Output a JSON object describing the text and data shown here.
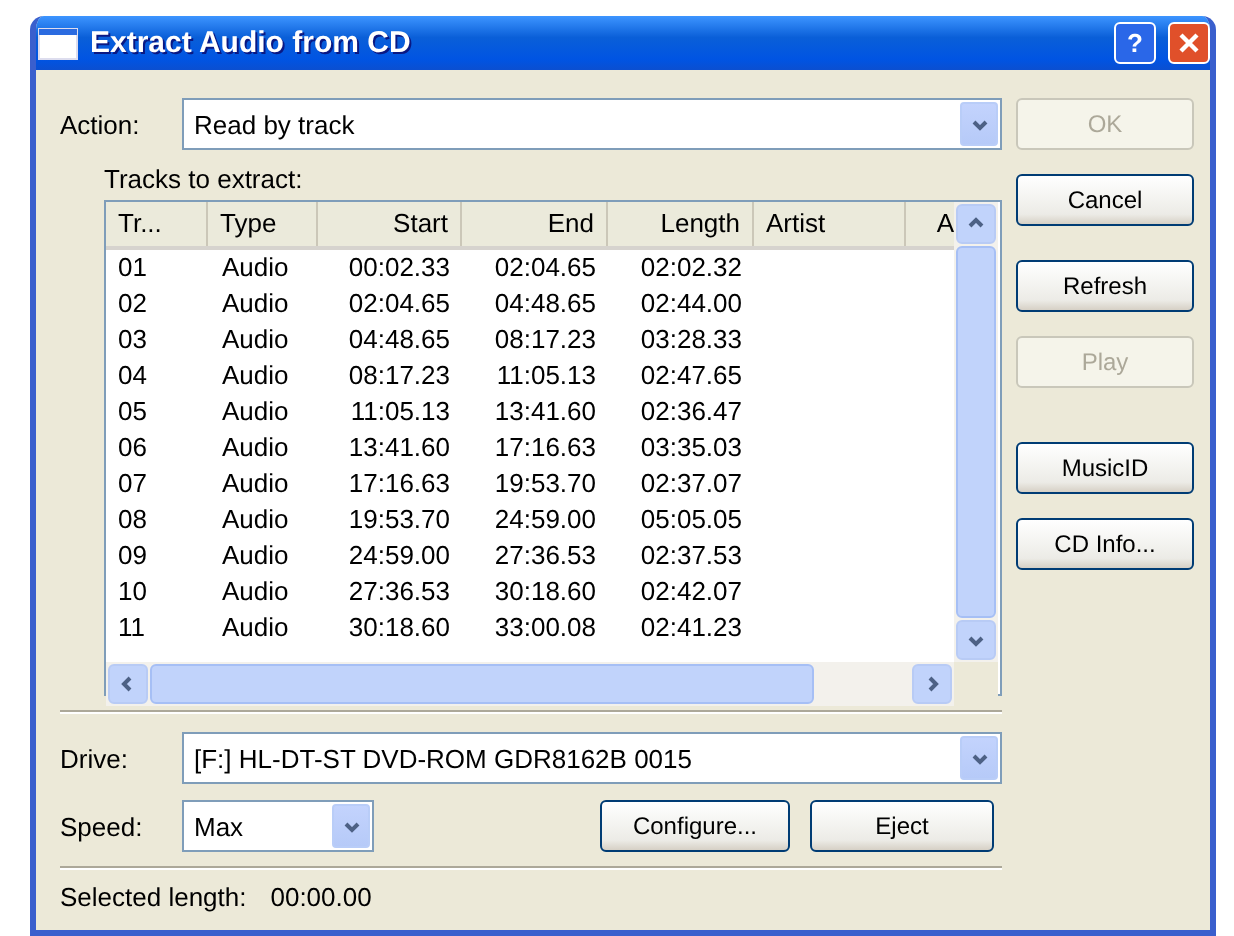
{
  "window": {
    "title": "Extract Audio from CD",
    "help_button": "?"
  },
  "action": {
    "label": "Action:",
    "value": "Read by track"
  },
  "tracks": {
    "label": "Tracks to extract:",
    "columns": [
      {
        "label": "Tr..."
      },
      {
        "label": "Type"
      },
      {
        "label": "Start"
      },
      {
        "label": "End"
      },
      {
        "label": "Length"
      },
      {
        "label": "Artist"
      },
      {
        "label": "A"
      }
    ],
    "rows": [
      [
        "01",
        "Audio",
        "00:02.33",
        "02:04.65",
        "02:02.32"
      ],
      [
        "02",
        "Audio",
        "02:04.65",
        "04:48.65",
        "02:44.00"
      ],
      [
        "03",
        "Audio",
        "04:48.65",
        "08:17.23",
        "03:28.33"
      ],
      [
        "04",
        "Audio",
        "08:17.23",
        "11:05.13",
        "02:47.65"
      ],
      [
        "05",
        "Audio",
        "11:05.13",
        "13:41.60",
        "02:36.47"
      ],
      [
        "06",
        "Audio",
        "13:41.60",
        "17:16.63",
        "03:35.03"
      ],
      [
        "07",
        "Audio",
        "17:16.63",
        "19:53.70",
        "02:37.07"
      ],
      [
        "08",
        "Audio",
        "19:53.70",
        "24:59.00",
        "05:05.05"
      ],
      [
        "09",
        "Audio",
        "24:59.00",
        "27:36.53",
        "02:37.53"
      ],
      [
        "10",
        "Audio",
        "27:36.53",
        "30:18.60",
        "02:42.07"
      ],
      [
        "11",
        "Audio",
        "30:18.60",
        "33:00.08",
        "02:41.23"
      ]
    ]
  },
  "side_buttons": [
    {
      "label": "OK",
      "disabled": true
    },
    {
      "label": "Cancel",
      "disabled": false
    },
    {
      "label": "Refresh",
      "disabled": false
    },
    {
      "label": "Play",
      "disabled": true
    },
    {
      "label": "MusicID",
      "disabled": false
    },
    {
      "label": "CD Info...",
      "disabled": false
    }
  ],
  "drive": {
    "label": "Drive:",
    "value": "[F:] HL-DT-ST DVD-ROM GDR8162B 0015"
  },
  "speed": {
    "label": "Speed:",
    "value": "Max"
  },
  "bottom_buttons": [
    {
      "label": "Configure...",
      "disabled": false
    },
    {
      "label": "Eject",
      "disabled": false
    }
  ],
  "status": {
    "label": "Selected length:",
    "value": "00:00.00"
  }
}
